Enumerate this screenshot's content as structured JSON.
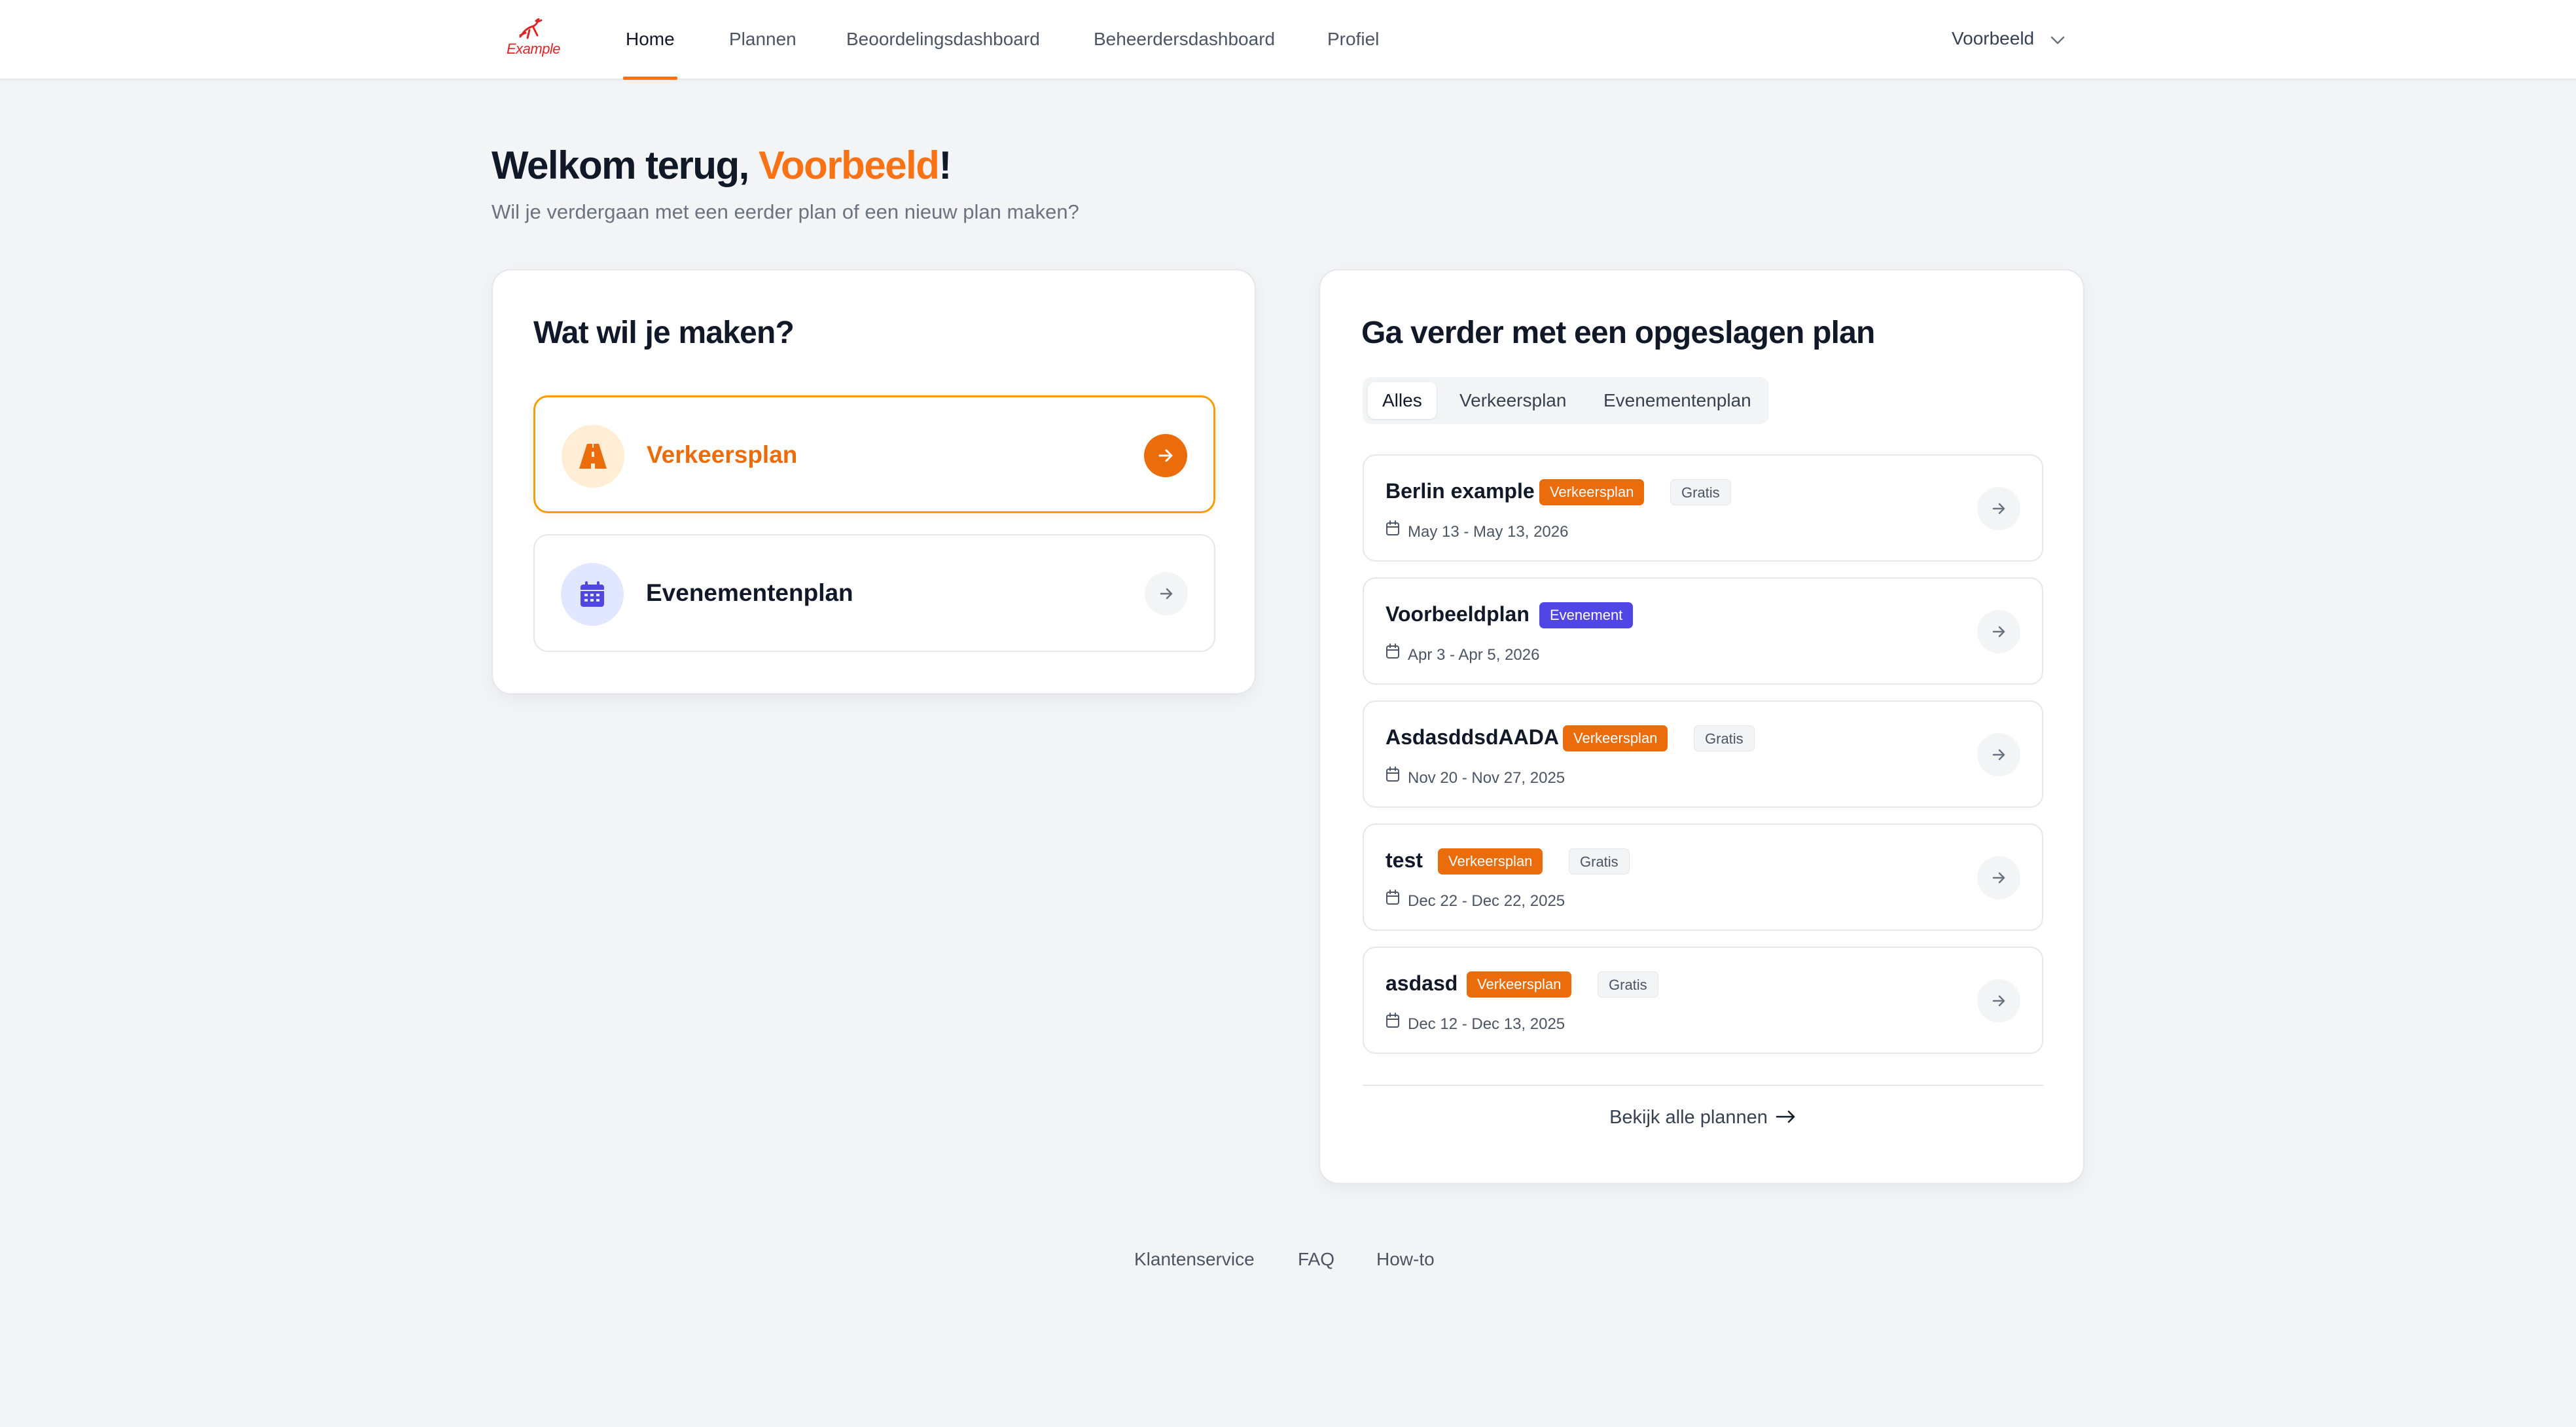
{
  "brand": {
    "logo_text": "Example",
    "logo_icon": "deer-icon",
    "accent_color": "#f97316"
  },
  "nav": {
    "items": [
      {
        "label": "Home",
        "active": true
      },
      {
        "label": "Plannen",
        "active": false
      },
      {
        "label": "Beoordelingsdashboard",
        "active": false
      },
      {
        "label": "Beheerdersdashboard",
        "active": false
      },
      {
        "label": "Profiel",
        "active": false
      }
    ],
    "user": {
      "name": "Voorbeeld",
      "icon": "chevron-down-icon"
    }
  },
  "header": {
    "welcome_prefix": "Welkom terug, ",
    "welcome_name": "Voorbeeld",
    "welcome_suffix": "!",
    "subtitle": "Wil je verdergaan met een eerder plan of een nieuw plan maken?"
  },
  "create": {
    "title": "Wat wil je maken?",
    "options": [
      {
        "label": "Verkeersplan",
        "icon": "road-icon",
        "selected": true
      },
      {
        "label": "Evenementenplan",
        "icon": "calendar-icon",
        "selected": false
      }
    ]
  },
  "saved": {
    "title": "Ga verder met een opgeslagen plan",
    "filters": [
      {
        "label": "Alles",
        "active": true
      },
      {
        "label": "Verkeersplan",
        "active": false
      },
      {
        "label": "Evenementenplan",
        "active": false
      }
    ],
    "plans": [
      {
        "name": "Berlin example",
        "type_badge": "Verkeersplan",
        "type_color": "orange",
        "extra_badge": "Gratis",
        "dates": "May 13 - May 13, 2026"
      },
      {
        "name": "Voorbeeldplan",
        "type_badge": "Evenement",
        "type_color": "purple",
        "extra_badge": "",
        "dates": "Apr 3 - Apr 5, 2026"
      },
      {
        "name": "AsdasddsdAADA",
        "type_badge": "Verkeersplan",
        "type_color": "orange",
        "extra_badge": "Gratis",
        "dates": "Nov 20 - Nov 27, 2025"
      },
      {
        "name": "test",
        "type_badge": "Verkeersplan",
        "type_color": "orange",
        "extra_badge": "Gratis",
        "dates": "Dec 22 - Dec 22, 2025"
      },
      {
        "name": "asdasd",
        "type_badge": "Verkeersplan",
        "type_color": "orange",
        "extra_badge": "Gratis",
        "dates": "Dec 12 - Dec 13, 2025"
      }
    ],
    "view_all": "Bekijk alle plannen"
  },
  "footer": {
    "links": [
      "Klantenservice",
      "FAQ",
      "How-to"
    ]
  }
}
